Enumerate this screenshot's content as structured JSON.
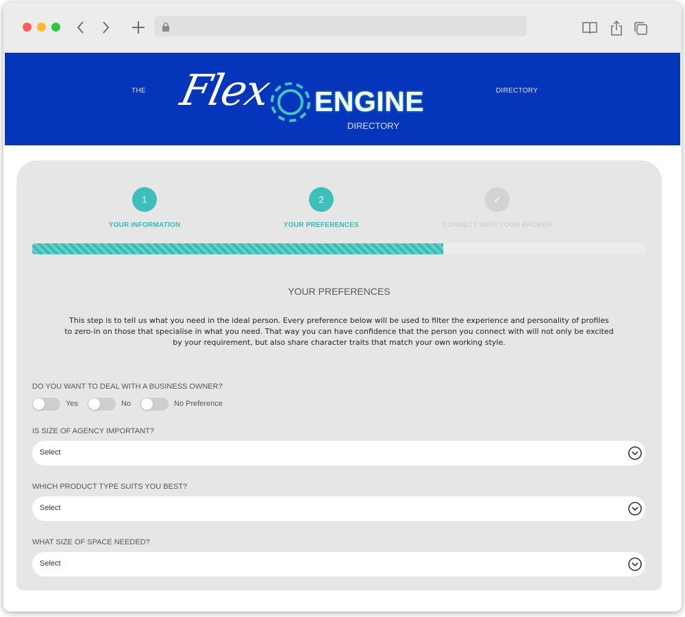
{
  "browser": {
    "address_value": ""
  },
  "banner": {
    "left_text": "THE",
    "right_text": "DIRECTORY",
    "logo_script": "Flex",
    "logo_word": "ENGINE",
    "logo_sub": "DIRECTORY"
  },
  "steps": [
    {
      "number": "1",
      "label": "YOUR INFORMATION",
      "state": "active"
    },
    {
      "number": "2",
      "label": "YOUR PREFERENCES",
      "state": "active"
    },
    {
      "number": "✓",
      "label": "CONNECT WITH YOUR BROKER",
      "state": "inactive"
    }
  ],
  "progress": {
    "fraction": 0.67
  },
  "section": {
    "title": "YOUR PREFERENCES",
    "description": "This step is to tell us what you need in the ideal person. Every preference below will be used to filter the experience and personality of profiles to zero-in on those that specialise in what you need. That way you can have confidence that the person you connect with will not only be excited by your requirement, but also share character traits that match your own working style."
  },
  "questions": {
    "business_owner": {
      "label": "DO YOU WANT TO DEAL WITH A BUSINESS OWNER?",
      "options": [
        "Yes",
        "No",
        "No Preference"
      ]
    },
    "agency_size": {
      "label": "IS SIZE OF AGENCY IMPORTANT?",
      "value": "Select"
    },
    "product_type": {
      "label": "WHICH PRODUCT TYPE SUITS YOU BEST?",
      "value": "Select"
    },
    "space_size": {
      "label": "WHAT SIZE OF SPACE NEEDED?",
      "value": "Select"
    }
  },
  "colors": {
    "banner": "#0535bb",
    "accent": "#3ebfb9",
    "card": "#e6e6e6"
  }
}
